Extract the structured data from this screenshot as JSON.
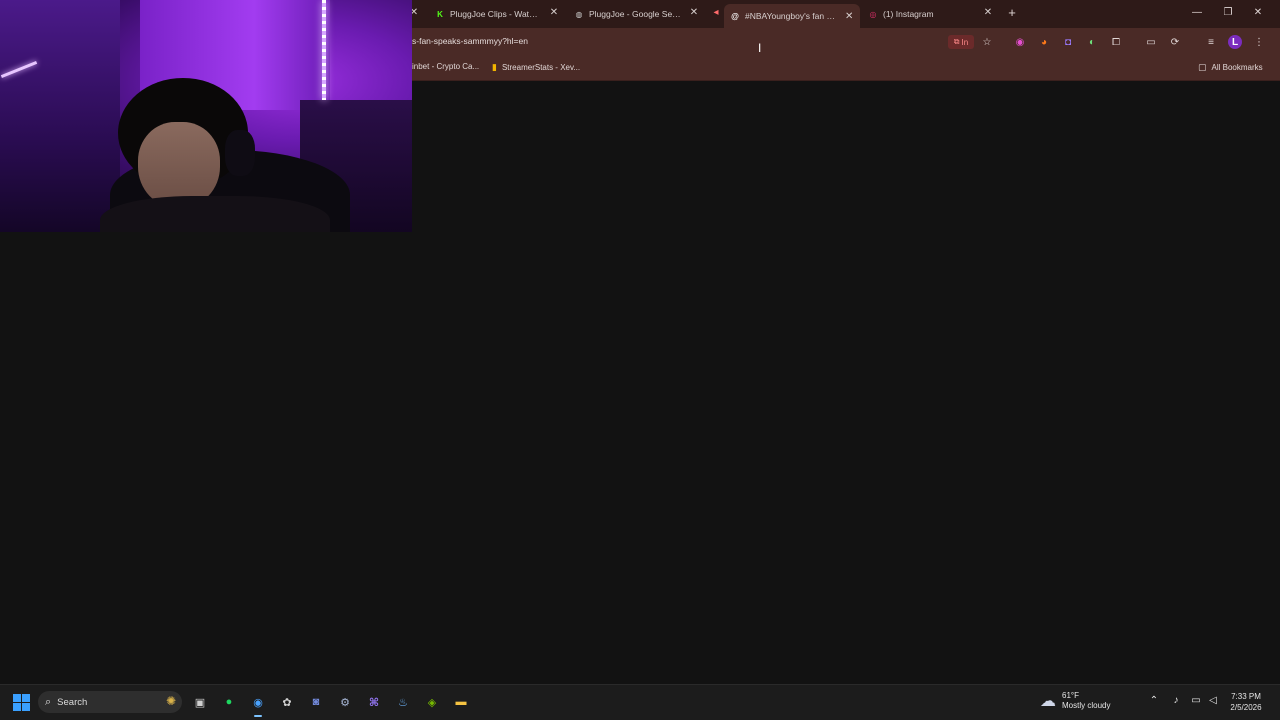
{
  "browser": {
    "tabs": [
      {
        "title": "PluggJoe Clips - Watch Li",
        "icon": "kick-icon",
        "icon_color": "#53fc18"
      },
      {
        "title": "PluggJoe - Google Search",
        "icon": "globe-icon",
        "icon_color": "#cfcfcf"
      },
      {
        "title": "#NBAYoungboy's fan spea",
        "icon": "threads-icon",
        "icon_color": "#ffffff",
        "active": true
      },
      {
        "title": "(1) Instagram",
        "icon": "instagram-icon",
        "icon_color": "#e1306c"
      }
    ],
    "new_tab_label": "+",
    "window_controls": {
      "minimize": "—",
      "maximize": "❐",
      "close": "✕"
    },
    "address_bar": {
      "url_text": "s-fan-speaks-sammmyy?hl=en",
      "install_label": "In"
    },
    "bookmarks": [
      {
        "label": "inbet - Crypto Ca..."
      },
      {
        "label": "StreamerStats - Xev..."
      }
    ],
    "all_bookmarks_label": "All Bookmarks",
    "profile_initial": "L",
    "accent": "#4a2a26"
  },
  "taskbar": {
    "search_label": "Search",
    "weather": {
      "temp": "61°F",
      "condition": "Mostly cloudy"
    },
    "clock": {
      "time": "7:33 PM",
      "date": "2/5/2026"
    }
  }
}
